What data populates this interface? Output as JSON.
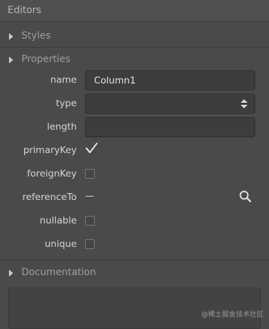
{
  "panel": {
    "title": "Editors"
  },
  "sections": {
    "styles": "Styles",
    "properties": "Properties",
    "documentation": "Documentation"
  },
  "properties": {
    "name": {
      "label": "name",
      "value": "Column1"
    },
    "type": {
      "label": "type",
      "value": ""
    },
    "length": {
      "label": "length",
      "value": ""
    },
    "primaryKey": {
      "label": "primaryKey",
      "checked": true
    },
    "foreignKey": {
      "label": "foreignKey",
      "checked": false
    },
    "referenceTo": {
      "label": "referenceTo",
      "value": "—"
    },
    "nullable": {
      "label": "nullable",
      "checked": false
    },
    "unique": {
      "label": "unique",
      "checked": false
    }
  },
  "watermark": "@稀土掘金技术社区",
  "icons": {
    "section_toggle": "triangle-right-icon",
    "type_stepper": "chevron-updown-icon",
    "primary_key_check": "checkmark-icon",
    "reference_search": "search-icon"
  }
}
